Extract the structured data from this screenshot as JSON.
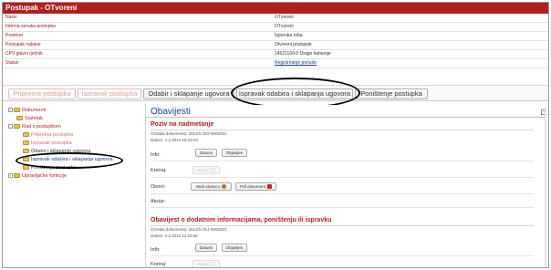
{
  "header": {
    "title": "Postupak - OTvoreni"
  },
  "properties": [
    {
      "key": "Naziv",
      "value": "OTvoreni",
      "link": false
    },
    {
      "key": "Interna oznaka postupka",
      "value": "OTvoreni",
      "link": false
    },
    {
      "key": "Predmet",
      "value": "Isporuka roba",
      "link": false
    },
    {
      "key": "Postupak nabave",
      "value": "Otvoreni postupak",
      "link": false
    },
    {
      "key": "CPV glavni rječnik",
      "value": "14521100-0 Drago kamenje",
      "link": false
    },
    {
      "key": "Status",
      "value": "Registriranje ponude",
      "link": true
    }
  ],
  "toolbar": {
    "buttons": [
      {
        "label": "Priprema postupka",
        "disabled": true
      },
      {
        "label": "Ispravak postupka",
        "disabled": true
      },
      {
        "label": "Odabir i sklapanje ugovora",
        "disabled": false
      },
      {
        "label": "Ispravak odabira i sklapanja ugovora",
        "disabled": false
      },
      {
        "label": "Poništenje postupka",
        "disabled": false
      }
    ]
  },
  "tree": {
    "items": [
      {
        "label": "Dokumenti",
        "level": 0,
        "toggle": "+"
      },
      {
        "label": "Sažetak",
        "level": 0,
        "toggle": ""
      },
      {
        "label": "Rad s postupkom",
        "level": 0,
        "toggle": "-"
      },
      {
        "label": "Priprema postupka",
        "level": 1,
        "toggle": ""
      },
      {
        "label": "Ispravak postupka",
        "level": 1,
        "toggle": ""
      },
      {
        "label": "Odabir i sklapanje ugovora",
        "level": 1,
        "toggle": ""
      },
      {
        "label": "Ispravak odabira i sklapanja ugovora",
        "level": 1,
        "toggle": ""
      },
      {
        "label": "Poništenje postupka",
        "level": 1,
        "toggle": ""
      },
      {
        "label": "Upravljačke funkcije",
        "level": 0,
        "toggle": "+"
      }
    ]
  },
  "panel": {
    "title": "Obavijesti",
    "collapse_symbol": "-",
    "notices": [
      {
        "title": "Poziv na nadmetanje",
        "doc_number": "Oznaka dokumenta: 2012/S 002-0000022",
        "date": "Datum: 1.2.2012 16:19:04",
        "info_label": "Info:",
        "info_buttons": [
          "Datumi",
          "Objavljen"
        ],
        "create_label": "Kreiraj:",
        "create_button": "Ispravi",
        "open_label": "Otvori:",
        "open_buttons": [
          "Web stranicu",
          "Pdf dokument"
        ],
        "actions_label": "Akcije:"
      },
      {
        "title": "Obavijest o dodatnim informacijama, poništenju ili ispravku",
        "doc_number": "Oznaka dokumenta: 2012/S 014-0000023",
        "date": "Datum: 2.2.2012 11:15:55",
        "info_label": "Info:",
        "info_buttons": [
          "Datumi",
          "Objavljen"
        ],
        "create_label": "Kreiraj:",
        "create_button": "Ispravi"
      }
    ]
  },
  "colors": {
    "brand_red": "#b01e1e",
    "link_blue": "#1a3d8f",
    "folder_yellow": "#e8c25a"
  }
}
